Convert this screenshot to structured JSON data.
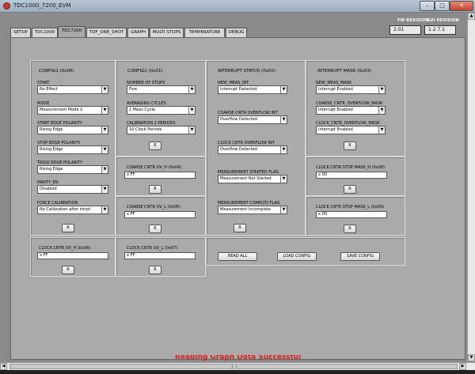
{
  "window": {
    "title": "TDC1000_7200_EVM",
    "minimize": "–",
    "maximize": "□",
    "close": "✕"
  },
  "revisions": {
    "fw_label": "FW REVISION",
    "fw_value": "2.01",
    "gui_label": "GUI REVISION",
    "gui_value": "1.2.7.1"
  },
  "tabs": [
    "SETUP",
    "TDC1000",
    "TDC7200",
    "TOF_ONE_SHOT",
    "GRAPH",
    "MULTI STOPS",
    "TEMPERATURE",
    "DEBUG"
  ],
  "active_tab": "TDC7200",
  "config1": {
    "title": "CONFIG1 (0x00)",
    "start": {
      "label": "START",
      "value": "No Effect"
    },
    "mode": {
      "label": "MODE",
      "value": "Measurement Mode 2"
    },
    "start_edge": {
      "label": "START EDGE POLARITY",
      "value": "Rising Edge"
    },
    "stop_edge": {
      "label": "STOP EDGE POLARITY",
      "value": "Rising Edge"
    },
    "trigg_edge": {
      "label": "TRIGG EDGE POLARITY",
      "value": "Rising Edge"
    },
    "parity": {
      "label": "PARITY_EN",
      "value": "Disabled"
    },
    "force_cal": {
      "label": "FORCE CALIBRATION",
      "value": "No Calibration after intrpt"
    },
    "read_btn": "R"
  },
  "config2": {
    "title": "CONFIG2 (0x01)",
    "num_stops": {
      "label": "NUMBER OF STOPS",
      "value": "Five"
    },
    "avg_cycles": {
      "label": "AVERAGING CYCLES",
      "value": "1 Meas Cycle"
    },
    "cal2_periods": {
      "label": "CALIBRATION 2 PERIODS",
      "value": "10 Clock Periods"
    },
    "read_btn": "R"
  },
  "coarse_ovh": {
    "title": "COARSE CNTR OV_H (0x04)",
    "value": "FF",
    "read_btn": "R"
  },
  "coarse_ovl": {
    "title": "COARSE CNTR OV_L (0x05)",
    "value": "FF",
    "read_btn": "R"
  },
  "clock_ovh": {
    "title": "CLOCK CNTR OV_H (0x06)",
    "value": "FF",
    "read_btn": "R"
  },
  "clock_ovl": {
    "title": "CLOCK CNTR OV_L (0x07)",
    "value": "FF",
    "read_btn": "R"
  },
  "int_status": {
    "title": "INTERRUPT STATUS (0x02)",
    "new_meas": {
      "label": "NEW_MEAS_INT",
      "value": "Interrupt Detected"
    },
    "coarse_of": {
      "label": "COARSE CNTR OVERFLOW INT",
      "value": "Overflow Detected"
    },
    "clock_of": {
      "label": "CLOCK CNTR OVERFLOW INT",
      "value": "Overflow Detected"
    },
    "meas_started": {
      "label": "MEASUREMENT STARTED FLAG",
      "value": "Measurement Not Started"
    },
    "meas_compltd": {
      "label": "MEASUREMENT COMPLTD FLAG",
      "value": "Measurement Incomplete"
    },
    "read_btn": "R"
  },
  "int_mask": {
    "title": "INTERRUPT MASK (0x03)",
    "new_meas_mask": {
      "label": "NEW_MEAS_MASK",
      "value": "Interrupt Enabled"
    },
    "coarse_mask": {
      "label": "COARSE_CNTR_OVERFLOW_MASK",
      "value": "Interrupt Enabled"
    },
    "clock_mask": {
      "label": "CLOCK_CNTR_OVERFLOW_MASK",
      "value": "Interrupt Enabled"
    },
    "read_btn": "R"
  },
  "stop_mask_h": {
    "title": "CLOCK CNTR STOP MASK_H (0x08)",
    "value": "00",
    "read_btn": "R"
  },
  "stop_mask_l": {
    "title": "CLOCK CNTR STOP MASK_L (0x09)",
    "value": "00",
    "read_btn": "R"
  },
  "hex_prefix": "x",
  "actions": {
    "read_all": "READ ALL",
    "load_config": "LOAD CONFIG",
    "save_config": "SAVE CONFIG"
  },
  "status_message": "Reading Graph Data Successful",
  "colors": {
    "status_text": "#e21b1b",
    "panel_bg": "#aaaaaa"
  }
}
